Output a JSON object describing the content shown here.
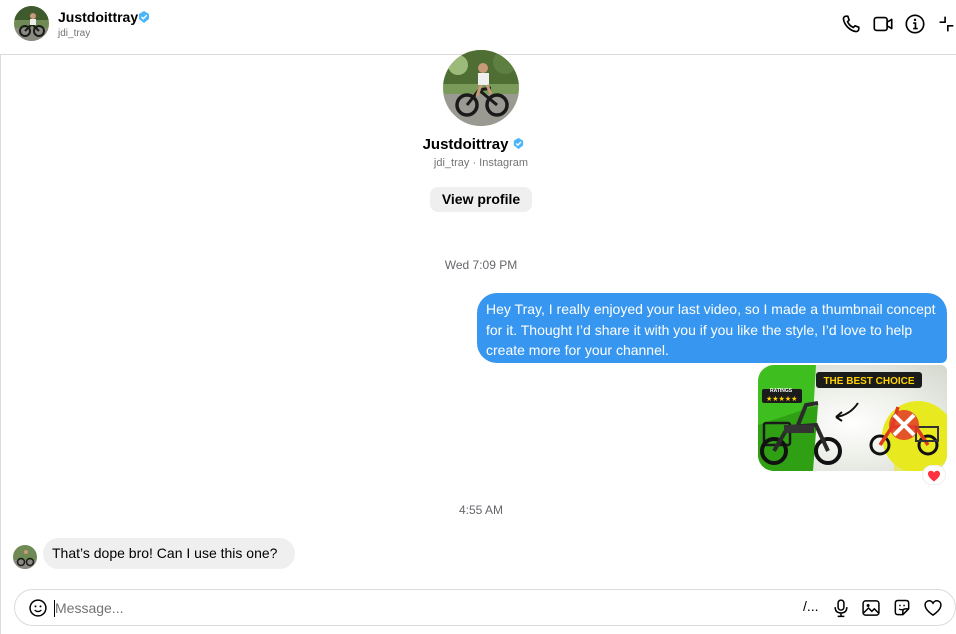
{
  "header": {
    "name": "Justdoittray",
    "username": "jdi_tray",
    "icons": [
      "phone-icon",
      "video-camera-icon",
      "info-icon",
      "collapse-icon"
    ]
  },
  "profile": {
    "name": "Justdoittray",
    "subtitle": "jdi_tray · Instagram",
    "view_profile_label": "View profile"
  },
  "messages": {
    "timestamp_1": "Wed 7:09 PM",
    "outgoing_text": "Hey Tray, I really enjoyed your last video, so I made a thumbnail concept for it. Thought I’d share it with you if you like the style, I’d love to help create more for your channel.",
    "thumbnail": {
      "badge_text": "THE BEST CHOICE",
      "ratings_text": "RATINGS",
      "stars": "★★★★★"
    },
    "reaction": "❤",
    "timestamp_2": "4:55 AM",
    "incoming_text": "That’s dope bro! Can I use this one?"
  },
  "composer": {
    "placeholder": "Message...",
    "value": "",
    "shortcut_label": "/..."
  },
  "colors": {
    "accent": "#3797f0",
    "verified": "#4cb5f9",
    "incoming_bubble": "#efefef",
    "heart": "#ff3040"
  }
}
